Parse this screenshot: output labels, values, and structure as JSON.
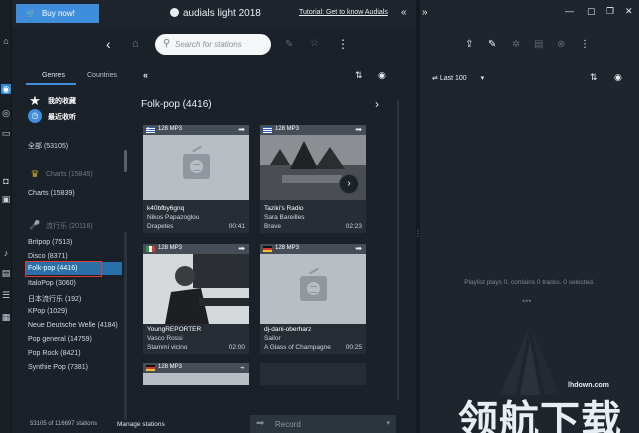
{
  "app": {
    "title": "audials light 2018",
    "buy_label": "Buy now!",
    "tutorial_link": "Tutorial: Get to know Audials"
  },
  "search": {
    "placeholder": "Search for stations",
    "value": ""
  },
  "genres": {
    "tabs": [
      "Genres",
      "Countries"
    ],
    "favorites": "我的收藏",
    "recent": "最近收听",
    "items": [
      {
        "label": "全部 (53105)"
      },
      {
        "label": "Charts (15845)"
      },
      {
        "label": "Charts (15839)"
      },
      {
        "label": "流行乐 (20116)"
      },
      {
        "label": "Britpop (7513)"
      },
      {
        "label": "Disco (8371)"
      },
      {
        "label": "Folk-pop (4416)"
      },
      {
        "label": "ItaloPop (3060)"
      },
      {
        "label": "日本流行乐 (192)"
      },
      {
        "label": "KPop (1029)"
      },
      {
        "label": "Neue Deutsche Welle (4184)"
      },
      {
        "label": "Pop general (14759)"
      },
      {
        "label": "Pop Rock (8421)"
      },
      {
        "label": "Synthie Pop (7381)"
      }
    ]
  },
  "main": {
    "heading": "Folk-pop (4416)",
    "cards": [
      {
        "rate": "128 MP3",
        "name": "k40bfby6gnq",
        "artist": "Nikos Papazoglou",
        "track": "Drapetes",
        "time": "00:41"
      },
      {
        "rate": "128 MP3",
        "name": "Taziki's Radio",
        "artist": "Sara Bareilles",
        "track": "Brave",
        "time": "02:23"
      },
      {
        "rate": "128 MP3",
        "name": "YoungREPORTER",
        "artist": "Vasco Rossi",
        "track": "Stammi vicino",
        "time": "02:00"
      },
      {
        "rate": "128 MP3",
        "name": "dj-dani-oberharz",
        "artist": "Sailor",
        "track": "A Glass of Champagne",
        "time": "00:25"
      },
      {
        "rate": "128 MP3"
      }
    ]
  },
  "status": {
    "stations": "53105 of 116697 stations",
    "manage": "Manage stations",
    "record": "Record"
  },
  "right_panel": {
    "list": "Last 100",
    "playlist_status": "Playlist plays 0, contains 0 tracks. 0 selected."
  },
  "watermark": {
    "url": "lhdown.com",
    "text": "领航下载"
  },
  "colors": {
    "accent": "#3e8edb",
    "selected": "#2a6fa8",
    "highlight_box": "#e03c31",
    "background": "#1b2129"
  }
}
